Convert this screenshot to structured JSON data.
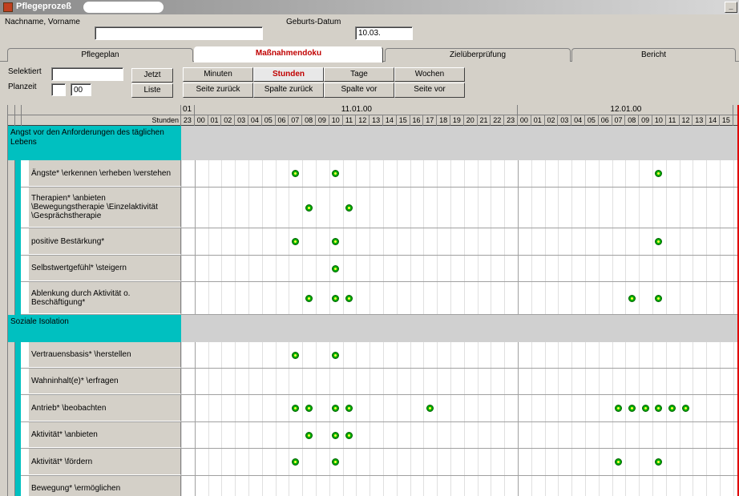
{
  "window": {
    "title": "Pflegeprozeß",
    "minimize": "_"
  },
  "patient": {
    "name_label": "Nachname, Vorname",
    "name_value": "",
    "dob_label": "Geburts-Datum",
    "dob_value": "10.03."
  },
  "tabs": [
    {
      "label": "Pflegeplan",
      "active": false
    },
    {
      "label": "Maßnahmendoku",
      "active": true
    },
    {
      "label": "Zielüberprüfung",
      "active": false
    },
    {
      "label": "Bericht",
      "active": false
    }
  ],
  "controls": {
    "selected_label": "Selektiert",
    "selected_value": "",
    "planned_label": "Planzeit",
    "planned_value": "00",
    "now_button": "Jetzt",
    "list_button": "Liste",
    "view_buttons": [
      {
        "label": "Minuten",
        "active": false
      },
      {
        "label": "Stunden",
        "active": true
      },
      {
        "label": "Tage",
        "active": false
      },
      {
        "label": "Wochen",
        "active": false
      }
    ],
    "nav_buttons": [
      {
        "label": "Seite zurück"
      },
      {
        "label": "Spalte zurück"
      },
      {
        "label": "Spalte vor"
      },
      {
        "label": "Seite vor"
      }
    ]
  },
  "timeline": {
    "row_label": "Stunden",
    "dates": [
      {
        "label": "01"
      },
      {
        "label": "11.01.00"
      },
      {
        "label": "12.01.00"
      }
    ],
    "hours": [
      "23",
      "00",
      "01",
      "02",
      "03",
      "04",
      "05",
      "06",
      "07",
      "08",
      "09",
      "10",
      "11",
      "12",
      "13",
      "14",
      "15",
      "16",
      "17",
      "18",
      "19",
      "20",
      "21",
      "22",
      "23",
      "00",
      "01",
      "02",
      "03",
      "04",
      "05",
      "06",
      "07",
      "08",
      "09",
      "10",
      "11",
      "12",
      "13",
      "14",
      "15"
    ]
  },
  "categories": [
    {
      "name": "Angst vor den Anforderungen des täglichen Lebens",
      "tasks": [
        {
          "name": "Ängste* \\erkennen \\erheben \\verstehen",
          "marks": [
            8,
            11,
            35
          ]
        },
        {
          "name": "Therapien* \\anbieten \\Bewegungstherapie \\Einzelaktivität \\Gesprächstherapie",
          "marks": [
            9,
            12
          ]
        },
        {
          "name": "positive Bestärkung*",
          "marks": [
            8,
            11,
            35
          ]
        },
        {
          "name": "Selbstwertgefühl* \\steigern",
          "marks": [
            11
          ]
        },
        {
          "name": "Ablenkung durch Aktivität o. Beschäftigung*",
          "marks": [
            9,
            11,
            12,
            33,
            35
          ]
        }
      ]
    },
    {
      "name": "Soziale Isolation",
      "tasks": [
        {
          "name": "Vertrauensbasis* \\herstellen",
          "marks": [
            8,
            11
          ]
        },
        {
          "name": "Wahninhalt(e)* \\erfragen",
          "marks": []
        },
        {
          "name": "Antrieb* \\beobachten",
          "marks": [
            8,
            9,
            11,
            12,
            18,
            32,
            33,
            34,
            35,
            36,
            37
          ]
        },
        {
          "name": "Aktivität* \\anbieten",
          "marks": [
            9,
            11,
            12
          ]
        },
        {
          "name": "Aktivität* \\fördern",
          "marks": [
            8,
            11,
            32,
            35
          ]
        },
        {
          "name": "Bewegung* \\ermöglichen",
          "marks": []
        }
      ]
    }
  ]
}
